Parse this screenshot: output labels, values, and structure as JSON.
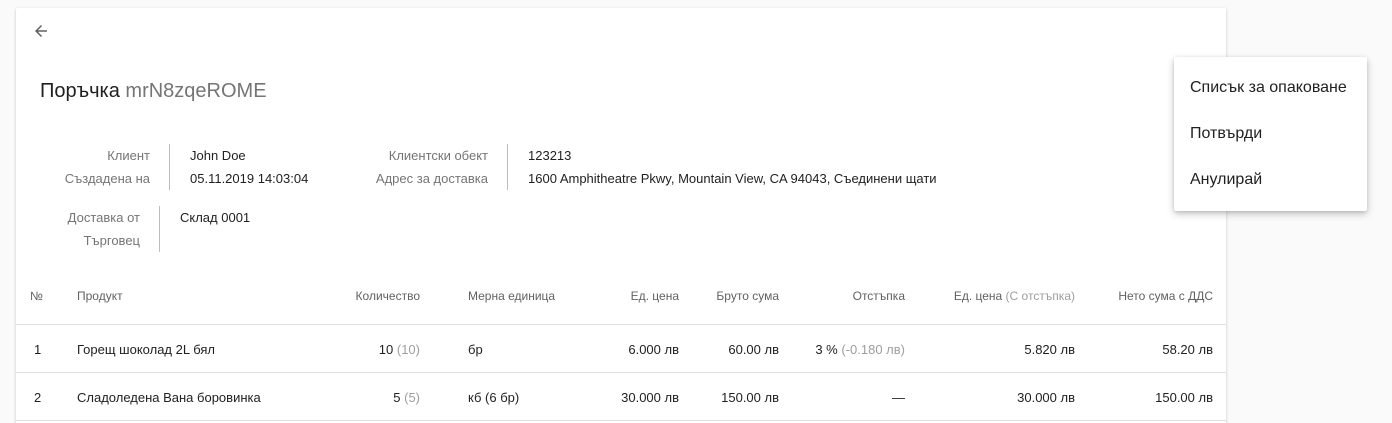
{
  "order": {
    "title_prefix": "Поръчка",
    "order_id": "mrN8zqeROME"
  },
  "info": {
    "client_label": "Клиент",
    "client_value": "John Doe",
    "created_label": "Създадена на",
    "created_value": "05.11.2019 14:03:04",
    "site_label": "Клиентски обект",
    "site_value": "123213",
    "address_label": "Адрес за доставка",
    "address_value": "1600 Amphitheatre Pkwy, Mountain View, CA 94043, Съединени щати",
    "delivery_label_line1": "Доставка от",
    "delivery_label_line2": "Търговец",
    "delivery_value": "Склад 0001"
  },
  "table": {
    "headers": {
      "no": "№",
      "product": "Продукт",
      "quantity": "Количество",
      "unit": "Мерна единица",
      "unit_price": "Ед. цена",
      "gross": "Бруто сума",
      "discount": "Отстъпка",
      "unit_price_disc": "Ед. цена",
      "unit_price_disc_note": "(С отстъпка)",
      "net": "Нето сума с ДДС"
    },
    "rows": [
      {
        "no": "1",
        "product": "Горещ шоколад 2L бял",
        "qty": "10",
        "qty_note": "(10)",
        "unit": "бр",
        "unit_price": "6.000 лв",
        "gross": "60.00 лв",
        "discount": "3 %",
        "discount_note": "(-0.180 лв)",
        "unit_price_disc": "5.820 лв",
        "net": "58.20 лв"
      },
      {
        "no": "2",
        "product": "Сладоледена Вана боровинка",
        "qty": "5",
        "qty_note": "(5)",
        "unit": "кб (6 бр)",
        "unit_price": "30.000 лв",
        "gross": "150.00 лв",
        "discount": "—",
        "discount_note": "",
        "unit_price_disc": "30.000 лв",
        "net": "150.00 лв"
      }
    ]
  },
  "menu": {
    "items": [
      "Списък за опаковане",
      "Потвърди",
      "Анулирай"
    ]
  },
  "icons": {
    "back": "arrow-left-icon"
  }
}
